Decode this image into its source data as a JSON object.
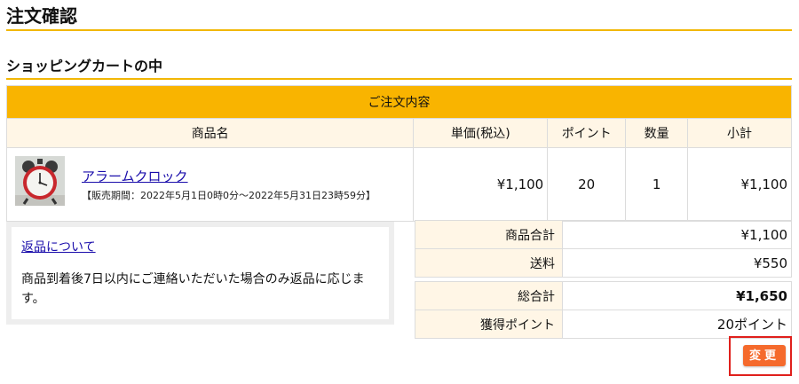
{
  "page": {
    "title": "注文確認"
  },
  "cart": {
    "section_title": "ショッピングカートの中",
    "banner": "ご注文内容",
    "columns": [
      "商品名",
      "単価(税込)",
      "ポイント",
      "数量",
      "小計"
    ],
    "items": [
      {
        "name": "アラームクロック",
        "period": "【販売期間：2022年5月1日0時0分～2022年5月31日23時59分】",
        "unit_price": "¥1,100",
        "points": "20",
        "quantity": "1",
        "subtotal": "¥1,100"
      }
    ]
  },
  "returns": {
    "link": "返品について",
    "text": "商品到着後7日以内にご連絡いただいた場合のみ返品に応じます。"
  },
  "summary": {
    "items_total_label": "商品合計",
    "items_total": "¥1,100",
    "shipping_label": "送料",
    "shipping": "¥550",
    "grand_total_label": "総合計",
    "grand_total": "¥1,650",
    "points_label": "獲得ポイント",
    "points": "20ポイント"
  },
  "actions": {
    "change": "変更"
  },
  "colors": {
    "accent": "#f9b400",
    "header_bg": "#fff6e6",
    "button": "#f56a2c",
    "highlight": "#e0201c"
  }
}
